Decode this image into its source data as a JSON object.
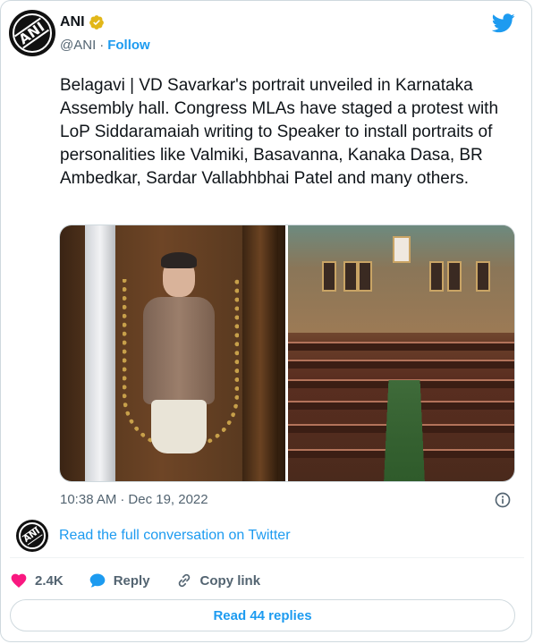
{
  "author": {
    "name": "ANI",
    "handle": "@ANI",
    "separator": "·",
    "follow_label": "Follow",
    "avatar_text": "ANI"
  },
  "icons": {
    "verified": "verified-badge-icon",
    "brand": "twitter-bird-icon",
    "info": "info-icon",
    "like": "heart-icon",
    "reply": "reply-bubble-icon",
    "copy": "link-icon"
  },
  "tweet": {
    "text": "Belagavi | VD Savarkar's portrait unveiled in Karnataka Assembly hall. Congress MLAs have staged a protest with LoP Siddaramaiah writing to Speaker to install portraits of personalities like Valmiki, Basavanna, Kanaka Dasa, BR Ambedkar, Sardar Vallabhbhai Patel and many others.",
    "time": "10:38 AM",
    "dot": "·",
    "date": "Dec 19, 2022"
  },
  "conversation": {
    "link_label": "Read the full conversation on Twitter"
  },
  "actions": {
    "likes": "2.4K",
    "reply_label": "Reply",
    "copy_label": "Copy link"
  },
  "footer": {
    "read_replies_label": "Read 44 replies"
  },
  "colors": {
    "accent": "#1d9bf0",
    "like": "#f91880",
    "verified": "#e2b719",
    "muted": "#536471"
  }
}
